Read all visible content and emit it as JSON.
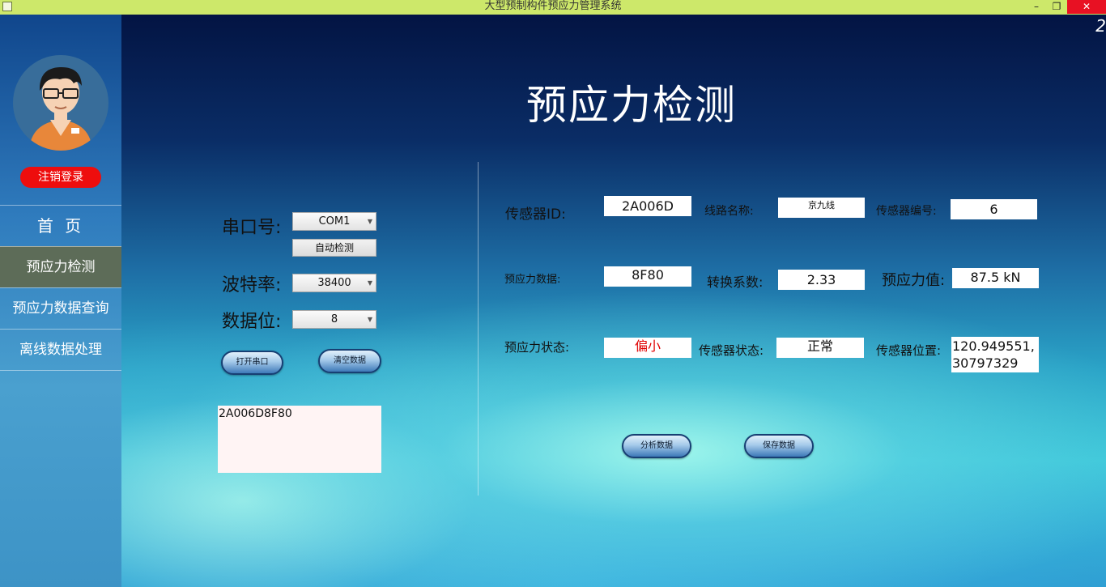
{
  "window": {
    "title": "大型预制构件预应力管理系统",
    "controls": {
      "minimize": "–",
      "maximize": "❐",
      "close": "✕"
    }
  },
  "sidebar": {
    "logout_label": "注销登录",
    "nav": [
      {
        "label": "首 页",
        "active": false
      },
      {
        "label": "预应力检测",
        "active": true
      },
      {
        "label": "预应力数据查询",
        "active": false
      },
      {
        "label": "离线数据处理",
        "active": false
      }
    ]
  },
  "main": {
    "corner_text": "2",
    "title": "预应力检测",
    "serial": {
      "port_label": "串口号:",
      "port_value": "COM1",
      "auto_detect_label": "自动检测",
      "baud_label": "波特率:",
      "baud_value": "38400",
      "databits_label": "数据位:",
      "databits_value": "8",
      "open_port_label": "打开串口",
      "clear_data_label": "清空数据",
      "received_text": "2A006D8F80"
    },
    "info": {
      "sensor_id_label": "传感器ID:",
      "sensor_id_value": "2A006D",
      "line_name_label": "线路名称:",
      "line_name_value": "京九线",
      "sensor_no_label": "传感器编号:",
      "sensor_no_value": "6",
      "prestress_data_label": "预应力数据:",
      "prestress_data_value": "8F80",
      "conversion_label": "转换系数:",
      "conversion_value": "2.33",
      "prestress_value_label": "预应力值:",
      "prestress_value_value": "87.5 kN",
      "prestress_status_label": "预应力状态:",
      "prestress_status_value": "偏小",
      "sensor_status_label": "传感器状态:",
      "sensor_status_value": "正常",
      "sensor_position_label": "传感器位置:",
      "sensor_position_lon": "120.949551,",
      "sensor_position_lat": "30797329",
      "analyze_label": "分析数据",
      "save_label": "保存数据"
    },
    "colors": {
      "status_warn": "#e00000",
      "logout": "#ee0d0d",
      "titlebar": "#cde86a",
      "active_nav": "#5d6c58"
    }
  }
}
